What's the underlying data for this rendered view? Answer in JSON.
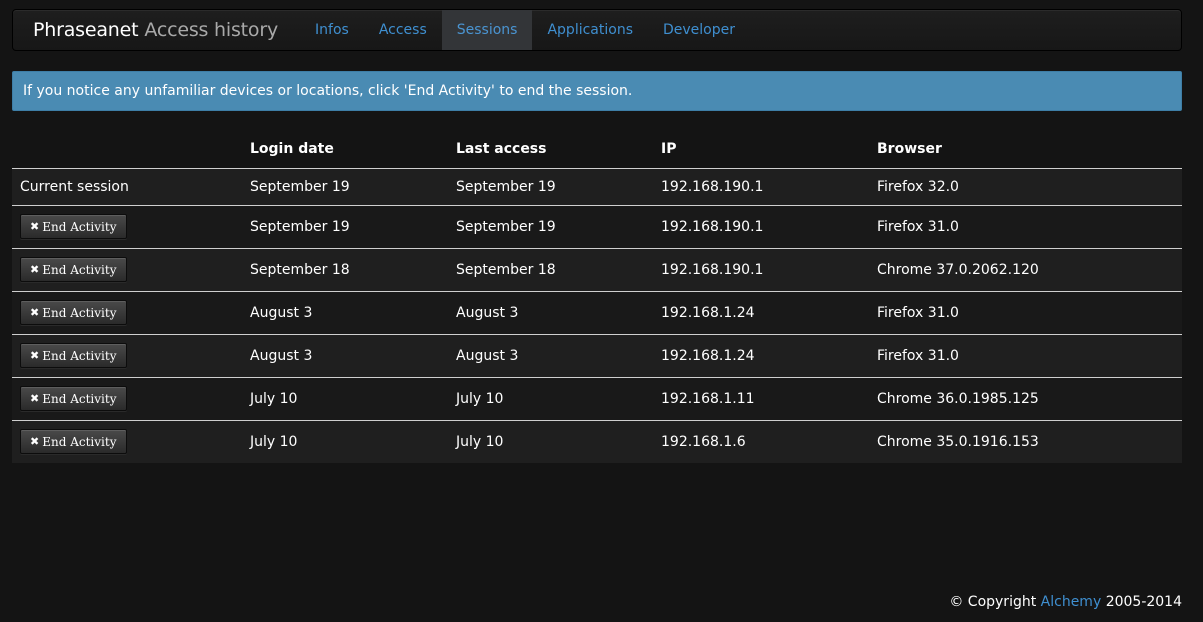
{
  "navbar": {
    "brand_main": "Phraseanet",
    "brand_sub": "Access history",
    "tabs": [
      {
        "label": "Infos"
      },
      {
        "label": "Access"
      },
      {
        "label": "Sessions"
      },
      {
        "label": "Applications"
      },
      {
        "label": "Developer"
      }
    ],
    "active_tab": "Sessions"
  },
  "alert": {
    "text": "If you notice any unfamiliar devices or locations, click 'End Activity' to end the session."
  },
  "table": {
    "headers": [
      "",
      "Login date",
      "Last access",
      "IP",
      "Browser"
    ],
    "current_label": "Current session",
    "end_label": "End Activity",
    "rows": [
      {
        "login": "September 19",
        "last": "September 19",
        "ip": "192.168.190.1",
        "browser": "Firefox 32.0"
      },
      {
        "login": "September 19",
        "last": "September 19",
        "ip": "192.168.190.1",
        "browser": "Firefox 31.0"
      },
      {
        "login": "September 18",
        "last": "September 18",
        "ip": "192.168.190.1",
        "browser": "Chrome 37.0.2062.120"
      },
      {
        "login": "August 3",
        "last": "August 3",
        "ip": "192.168.1.24",
        "browser": "Firefox 31.0"
      },
      {
        "login": "August 3",
        "last": "August 3",
        "ip": "192.168.1.24",
        "browser": "Firefox 31.0"
      },
      {
        "login": "July 10",
        "last": "July 10",
        "ip": "192.168.1.11",
        "browser": "Chrome 36.0.1985.125"
      },
      {
        "login": "July 10",
        "last": "July 10",
        "ip": "192.168.1.6",
        "browser": "Chrome 35.0.1916.153"
      }
    ]
  },
  "footer": {
    "copyright": "© Copyright",
    "company": "Alchemy",
    "years": "2005-2014"
  },
  "colors": {
    "background": "#141414",
    "link": "#3f8fd0",
    "alert": "#4a8bb3"
  }
}
